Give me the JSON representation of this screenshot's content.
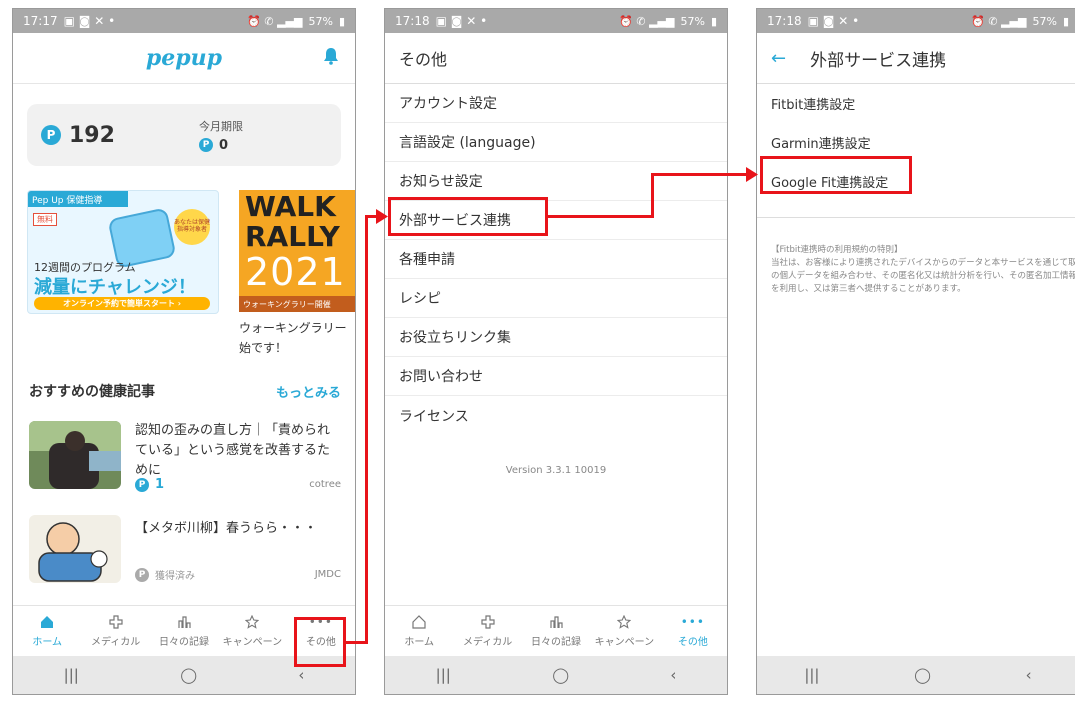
{
  "status_bar": [
    {
      "time": "17:17",
      "icons": "▣ ◙ ✕ •",
      "right": "57%"
    },
    {
      "time": "17:18",
      "icons": "▣ ◙ ✕ •",
      "right": "57%"
    },
    {
      "time": "17:18",
      "icons": "▣ ◙ ✕ •",
      "right": "57%"
    }
  ],
  "home": {
    "logo": "pepup",
    "points": "192",
    "month_label": "今月期限",
    "month_points": "0",
    "banner1": {
      "brand": "Pep Up 保健指導",
      "free": "無料",
      "badge": "あなたは保健指導対象者",
      "line1": "12週間のプログラム",
      "line2": "減量にチャレンジ！",
      "cta": "オンライン予約で簡単スタート ›"
    },
    "banner2": {
      "word1": "WALK",
      "word2": "RALLY",
      "year": "2021",
      "footer": "ウォーキングラリー開催",
      "caption": "ウォーキングラリー始です！"
    },
    "section_title": "おすすめの健康記事",
    "more": "もっとみる",
    "articles": [
      {
        "title": "認知の歪みの直し方｜「責められている」という感覚を改善するために",
        "points": "1",
        "source": "cotree"
      },
      {
        "title": "【メタボ川柳】春うらら・・・",
        "points": "獲得済み",
        "source": "JMDC"
      }
    ],
    "tabs": [
      "ホーム",
      "メディカル",
      "日々の記録",
      "キャンペーン",
      "その他"
    ]
  },
  "other": {
    "title": "その他",
    "items": [
      "アカウント設定",
      "言語設定 (language)",
      "お知らせ設定",
      "外部サービス連携",
      "各種申請",
      "レシピ",
      "お役立ちリンク集",
      "お問い合わせ",
      "ライセンス"
    ],
    "version": "Version 3.3.1 10019",
    "tabs": [
      "ホーム",
      "メディカル",
      "日々の記録",
      "キャンペーン",
      "その他"
    ]
  },
  "external": {
    "title": "外部サービス連携",
    "items": [
      "Fitbit連携設定",
      "Garmin連携設定",
      "Google Fit連携設定"
    ],
    "terms_title": "【Fitbit連携時の利用規約の特則】",
    "terms_body": "当社は、お客様により連携されたデバイスからのデータと本サービスを通じて取得したお客様の個人データを組み合わせ、その匿名化又は統計分析を行い、その匿名加工情報又は統計情報を利用し、又は第三者へ提供することがあります。"
  },
  "nav": {
    "recent": "|||",
    "home": "◯",
    "back": "‹"
  },
  "colors": {
    "accent": "#2aa9d6",
    "highlight": "#e8141a"
  }
}
